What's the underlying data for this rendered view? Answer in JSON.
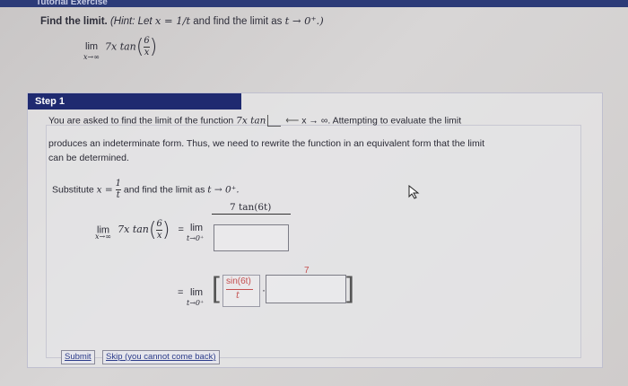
{
  "header": {
    "title": "Tutorial Exercise"
  },
  "problem": {
    "find_label": "Find the limit.",
    "hint_prefix": "(Hint: Let",
    "hint_eq": "x = 1/t",
    "hint_mid": "and find the limit as",
    "hint_var": "t → 0⁺.)",
    "lim": "lim",
    "lim_sub": "x→∞",
    "expr": "7x tan",
    "frac_num": "6",
    "frac_den": "x"
  },
  "step": {
    "title": "Step 1",
    "para1_a": "You are asked to find the limit of the function",
    "para1_fn": "7x tan",
    "para1_b": "x → ∞. Attempting to evaluate the limit",
    "para2": "produces an indeterminate form. Thus, we need to rewrite the function in an equivalent form that the limit",
    "para3": "can be determined.",
    "sub_a": "Substitute",
    "sub_x": "x =",
    "sub_num": "1",
    "sub_den": "t",
    "sub_b": "and find the limit as",
    "sub_t": "t → 0⁺.",
    "eq1_lim": "lim",
    "eq1_sub": "x→∞",
    "eq1_expr": "7x tan",
    "eq1_num": "6",
    "eq1_den": "x",
    "eq_sign": "=",
    "rhs_lim": "lim",
    "rhs_sub": "t→0⁺",
    "rhs_numerator": "7 tan(6t)",
    "eq2_sign": "=",
    "eq2_lim": "lim",
    "eq2_sub": "t→0⁺",
    "red_num": "sin(6t)",
    "red_den": "t",
    "red_dot": "·",
    "red_seven": "7"
  },
  "buttons": {
    "submit": "Submit",
    "skip": "Skip (you cannot come back)"
  }
}
